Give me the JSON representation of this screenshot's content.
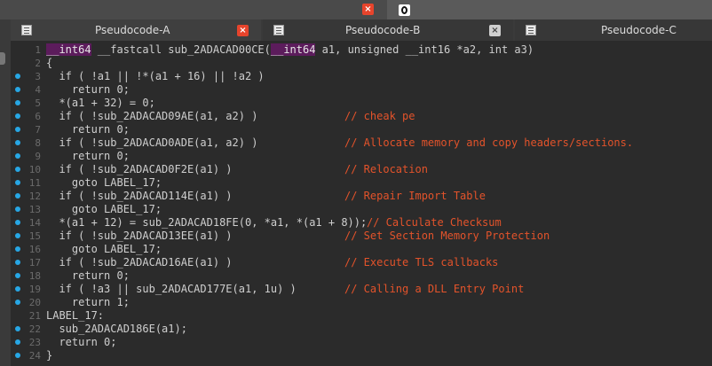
{
  "tabs": [
    {
      "label": "Pseudocode-A",
      "close": "×"
    },
    {
      "label": "Pseudocode-B",
      "close": "×"
    },
    {
      "label": "Pseudocode-C"
    }
  ],
  "topbar": {
    "close": "×"
  },
  "lines": [
    {
      "n": "1",
      "bp": false,
      "pre": "",
      "kw": "__int64",
      "code": " __fastcall sub_2ADACAD00CE(",
      "kw2": "__int64",
      "code2": " a1, unsigned __int16 *a2, int a3)",
      "comment": ""
    },
    {
      "n": "2",
      "bp": false,
      "code": "{",
      "comment": ""
    },
    {
      "n": "3",
      "bp": true,
      "code": "  if ( !a1 || !*(a1 + 16) || !a2 )",
      "comment": ""
    },
    {
      "n": "4",
      "bp": true,
      "code": "    return 0;",
      "comment": ""
    },
    {
      "n": "5",
      "bp": true,
      "code": "  *(a1 + 32) = 0;",
      "comment": ""
    },
    {
      "n": "6",
      "bp": true,
      "code": "  if ( !sub_2ADACAD09AE(a1, a2) )",
      "comment": "// cheak pe"
    },
    {
      "n": "7",
      "bp": true,
      "code": "    return 0;",
      "comment": ""
    },
    {
      "n": "8",
      "bp": true,
      "code": "  if ( !sub_2ADACAD0ADE(a1, a2) )",
      "comment": "// Allocate memory and copy headers/sections."
    },
    {
      "n": "9",
      "bp": true,
      "code": "    return 0;",
      "comment": ""
    },
    {
      "n": "10",
      "bp": true,
      "code": "  if ( !sub_2ADACAD0F2E(a1) )",
      "comment": "// Relocation"
    },
    {
      "n": "11",
      "bp": true,
      "code": "    goto LABEL_17;",
      "comment": ""
    },
    {
      "n": "12",
      "bp": true,
      "code": "  if ( !sub_2ADACAD114E(a1) )",
      "comment": "// Repair Import Table"
    },
    {
      "n": "13",
      "bp": true,
      "code": "    goto LABEL_17;",
      "comment": ""
    },
    {
      "n": "14",
      "bp": true,
      "code": "  *(a1 + 12) = sub_2ADACAD18FE(0, *a1, *(a1 + 8));",
      "comment": "// Calculate Checksum",
      "cmtLeft": true
    },
    {
      "n": "15",
      "bp": true,
      "code": "  if ( !sub_2ADACAD13EE(a1) )",
      "comment": "// Set Section Memory Protection"
    },
    {
      "n": "16",
      "bp": true,
      "code": "    goto LABEL_17;",
      "comment": ""
    },
    {
      "n": "17",
      "bp": true,
      "code": "  if ( !sub_2ADACAD16AE(a1) )",
      "comment": "// Execute TLS callbacks"
    },
    {
      "n": "18",
      "bp": true,
      "code": "    return 0;",
      "comment": ""
    },
    {
      "n": "19",
      "bp": true,
      "code": "  if ( !a3 || sub_2ADACAD177E(a1, 1u) )",
      "comment": "// Calling a DLL Entry Point"
    },
    {
      "n": "20",
      "bp": true,
      "code": "    return 1;",
      "comment": ""
    },
    {
      "n": "21",
      "bp": false,
      "code": "LABEL_17:",
      "comment": ""
    },
    {
      "n": "22",
      "bp": true,
      "code": "  sub_2ADACAD186E(a1);",
      "comment": ""
    },
    {
      "n": "23",
      "bp": true,
      "code": "  return 0;",
      "comment": ""
    },
    {
      "n": "24",
      "bp": true,
      "code": "}",
      "comment": ""
    }
  ]
}
